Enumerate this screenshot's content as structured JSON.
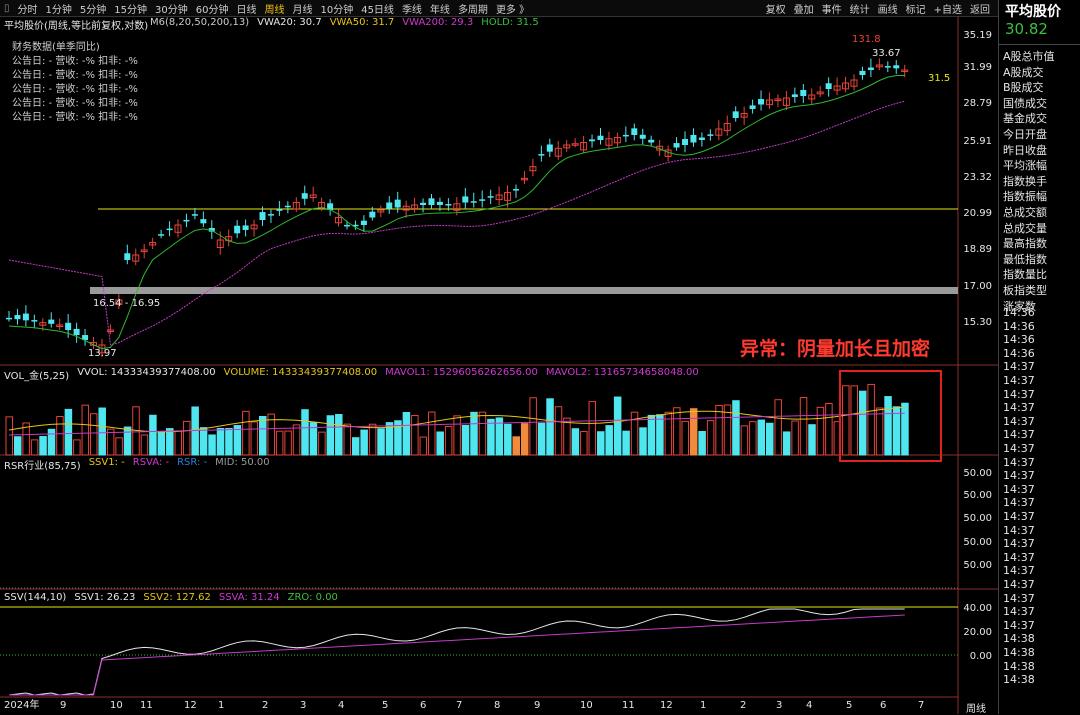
{
  "toolbar": {
    "periods": [
      "分时",
      "1分钟",
      "5分钟",
      "15分钟",
      "30分钟",
      "60分钟",
      "日线",
      "周线",
      "月线",
      "10分钟",
      "45日线",
      "季线",
      "年线",
      "多周期",
      "更多"
    ],
    "active": "周线",
    "right": [
      "复权",
      "叠加",
      "事件",
      "统计",
      "画线",
      "标记",
      "+自选",
      "返回"
    ]
  },
  "side": {
    "title": "平均股价",
    "price": "30.82",
    "items": [
      "A股总市值",
      "A股成交",
      "B股成交",
      "国债成交",
      "基金成交",
      "今日开盘",
      "昨日收盘",
      "平均涨幅",
      "指数换手",
      "指数振幅",
      "总成交额",
      "总成交量",
      "最高指数",
      "最低指数",
      "指数量比",
      "板指类型",
      "涨家数"
    ],
    "times": [
      "14:36",
      "14:36",
      "14:36",
      "14:36",
      "14:37",
      "14:37",
      "14:37",
      "14:37",
      "14:37",
      "14:37",
      "14:37",
      "14:37",
      "14:37",
      "14:37",
      "14:37",
      "14:37",
      "14:37",
      "14:37",
      "14:37",
      "14:37",
      "14:37",
      "14:37",
      "14:37",
      "14:37",
      "14:38",
      "14:38",
      "14:38",
      "14:38"
    ]
  },
  "main": {
    "title": "平均股价(周线,等比前复权,对数)",
    "legend": [
      {
        "text": "M6(8,20,50,200,13)",
        "color": "#cccccc"
      },
      {
        "text": "VWA20: 30.7",
        "color": "#e6e6e6"
      },
      {
        "text": "VWA50: 31.7",
        "color": "#e6c619"
      },
      {
        "text": "VWA200: 29.3",
        "color": "#d03ad0"
      },
      {
        "text": "HOLD: 31.5",
        "color": "#3cc03c"
      }
    ],
    "fin_title": "财务数据(单季同比)",
    "fin_rows": [
      "公告日: -    营收: -%    扣非: -%",
      "公告日: -    营收: -%    扣非: -%",
      "公告日: -    营收: -%    扣非: -%",
      "公告日: -    营收: -%    扣非: -%",
      "公告日: -    营收: -%    扣非: -%"
    ],
    "y_labels": [
      "35.19",
      "31.99",
      "28.79",
      "25.91",
      "23.32",
      "20.99",
      "18.89",
      "17.00",
      "15.30"
    ],
    "annotations": {
      "high": "131.8",
      "high2": "33.67",
      "last": "31.5",
      "range": "16.54 - 16.95",
      "low": "13.97"
    },
    "alert": "异常：阴量加长且加密"
  },
  "vol": {
    "legend": [
      {
        "text": "VOL_金(5,25)",
        "color": "#e6e6e6"
      },
      {
        "text": "VVOL: 14333439377408.00",
        "color": "#e6e6e6"
      },
      {
        "text": "VOLUME: 14333439377408.00",
        "color": "#e6c619"
      },
      {
        "text": "MAVOL1: 15296056262656.00",
        "color": "#d03ad0"
      },
      {
        "text": "MAVOL2: 13165734658048.00",
        "color": "#d03ad0"
      }
    ]
  },
  "rsr": {
    "legend": [
      {
        "text": "RSR行业(85,75)",
        "color": "#e6e6e6"
      },
      {
        "text": "SSV1: -",
        "color": "#e6c619"
      },
      {
        "text": "RSVA: -",
        "color": "#d03ad0"
      },
      {
        "text": "RSR: -",
        "color": "#2a7fd4"
      },
      {
        "text": "MID: 50.00",
        "color": "#9a9a9a"
      }
    ],
    "y_labels": [
      "50.00",
      "50.00",
      "50.00",
      "50.00",
      "50.00"
    ]
  },
  "ssv": {
    "legend": [
      {
        "text": "SSV(144,10)",
        "color": "#e6e6e6"
      },
      {
        "text": "SSV1: 26.23",
        "color": "#e6e6e6"
      },
      {
        "text": "SSV2: 127.62",
        "color": "#e6c619"
      },
      {
        "text": "SSVA: 31.24",
        "color": "#d03ad0"
      },
      {
        "text": "ZRO: 0.00",
        "color": "#3cc03c"
      }
    ],
    "y_labels": [
      "40.00",
      "20.00",
      "0.00"
    ]
  },
  "xaxis": {
    "labels": [
      "2024年",
      "9",
      "10",
      "11",
      "12",
      "1",
      "2",
      "3",
      "4",
      "5",
      "6",
      "7",
      "8",
      "9",
      "10",
      "11",
      "12",
      "1",
      "2",
      "3",
      "4",
      "5",
      "6",
      "7"
    ],
    "period": "周线"
  },
  "colors": {
    "up": "#e8433a",
    "down": "#4fe6f0",
    "orange": "#f08a3c",
    "ma_green": "#2fb82f",
    "ma_purple": "#c53bc5",
    "yellow": "#e6e619"
  }
}
